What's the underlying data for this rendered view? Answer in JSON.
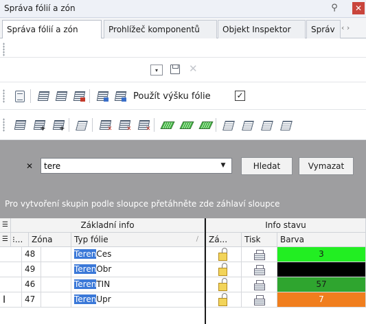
{
  "window": {
    "title": "Správa fólií a zón",
    "colors": {
      "close": "#c9453c"
    }
  },
  "tabs": [
    {
      "label": "Správa fólií a zón",
      "active": true
    },
    {
      "label": "Prohlížeč komponentů",
      "active": false
    },
    {
      "label": "Objekt Inspektor",
      "active": false
    },
    {
      "label": "Správ",
      "active": false
    }
  ],
  "tab_nav": "‹ ›",
  "toolbar3": {
    "label": "Použít výšku fólie",
    "check": "✓"
  },
  "filter": {
    "clear_label": "✕",
    "value": "tere",
    "dropdown": "▼",
    "search_label": "Hledat",
    "clear_button_label": "Vymazat",
    "group_hint": "Pro vytvoření skupin podle sloupce přetáhněte zde záhlaví sloupce"
  },
  "grid": {
    "band_basic": "Základní info",
    "band_status": "Info stavu",
    "columns": {
      "num": "⁝...",
      "zone": "Zóna",
      "type": "Typ fólie",
      "lock": "Zá...",
      "print": "Tisk",
      "color": "Barva"
    },
    "sort_indicator": "∕",
    "rows": [
      {
        "num": "48",
        "zone": "",
        "type_match": "Teren",
        "type_rest": "Ces",
        "color_value": "3",
        "color": "#22ee22",
        "color_text": "#111111"
      },
      {
        "num": "49",
        "zone": "",
        "type_match": "Teren",
        "type_rest": "Obr",
        "color_value": "",
        "color": "#000000",
        "color_text": "#ffffff"
      },
      {
        "num": "46",
        "zone": "",
        "type_match": "Teren",
        "type_rest": "TIN",
        "color_value": "57",
        "color": "#2fa52f",
        "color_text": "#111111"
      },
      {
        "num": "47",
        "zone": "",
        "type_match": "Teren",
        "type_rest": "Upr",
        "color_value": "7",
        "color": "#f07e1e",
        "color_text": "#ffffff"
      }
    ]
  },
  "icons": {
    "toolbar2": [
      "chevron-down-icon",
      "save-icon",
      "delete-icon"
    ],
    "toolbar3": [
      "import-icon",
      "layer-icon",
      "layer-outline-icon",
      "layer-red-icon",
      "layer-blue-icon",
      "layer-blue2-icon"
    ],
    "toolbar4": [
      "layer-select-icon",
      "layer-add-icon",
      "layer-add2-icon",
      "layer-list-icon",
      "layer-delete-icon",
      "layer-delete2-icon",
      "layer-delete3-icon",
      "green-layer-icon",
      "green-layer2-icon",
      "green-layer3-icon",
      "outline-layer-icon",
      "outline-layer2-icon",
      "outline-layer3-icon",
      "outline-layer4-icon"
    ]
  }
}
